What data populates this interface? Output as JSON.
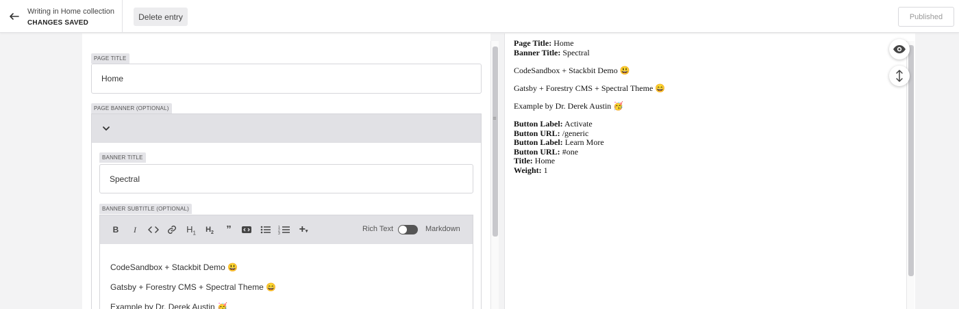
{
  "header": {
    "breadcrumb": "Writing in Home collection",
    "status": "CHANGES SAVED",
    "delete_label": "Delete entry",
    "published_label": "Published",
    "back_icon": "arrow-left-icon"
  },
  "editor": {
    "page_title": {
      "label": "PAGE TITLE",
      "value": "Home"
    },
    "page_banner": {
      "label": "PAGE BANNER (OPTIONAL)",
      "collapse_icon": "chevron-down-icon",
      "banner_title": {
        "label": "BANNER TITLE",
        "value": "Spectral"
      },
      "banner_subtitle": {
        "label": "BANNER SUBTITLE (OPTIONAL)",
        "toolbar": {
          "icons": [
            "bold-icon",
            "italic-icon",
            "code-icon",
            "link-icon",
            "heading-1-icon",
            "heading-2-icon",
            "quote-icon",
            "embed-icon",
            "bulleted-list-icon",
            "numbered-list-icon",
            "insert-icon"
          ],
          "rich_text_label": "Rich Text",
          "markdown_label": "Markdown",
          "mode": "Rich Text"
        },
        "lines": [
          "CodeSandbox + Stackbit Demo 😃",
          "Gatsby + Forestry CMS + Spectral Theme 😄",
          "Example by Dr. Derek Austin 🥳"
        ]
      }
    }
  },
  "preview": {
    "page_title_label": "Page Title:",
    "page_title_value": "Home",
    "banner_title_label": "Banner Title:",
    "banner_title_value": "Spectral",
    "lines": [
      "CodeSandbox + Stackbit Demo 😃",
      "Gatsby + Forestry CMS + Spectral Theme 😄",
      "Example by Dr. Derek Austin 🥳"
    ],
    "fields": [
      {
        "label": "Button Label:",
        "value": "Activate"
      },
      {
        "label": "Button URL:",
        "value": "/generic"
      },
      {
        "label": "Button Label:",
        "value": "Learn More"
      },
      {
        "label": "Button URL:",
        "value": "#one"
      },
      {
        "label": "Title:",
        "value": "Home"
      },
      {
        "label": "Weight:",
        "value": "1"
      }
    ],
    "eye_icon": "eye-icon",
    "scroll_sync_icon": "vertical-arrows-icon"
  }
}
